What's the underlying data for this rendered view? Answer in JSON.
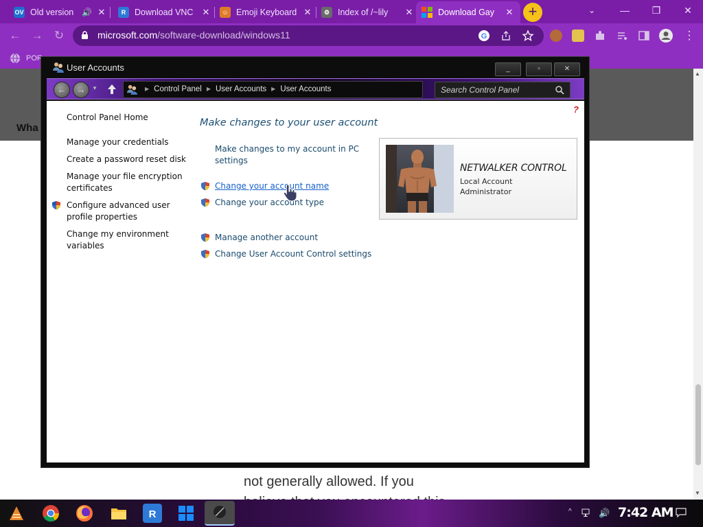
{
  "browser": {
    "tabs": [
      {
        "title": "Old version",
        "icon": "ov-icon",
        "icon_label": "OV",
        "icon_color": "#1f6fd1",
        "audio": true
      },
      {
        "title": "Download VNC",
        "icon": "realvnc-icon",
        "icon_label": "R",
        "icon_color": "#2d7ad6"
      },
      {
        "title": "Emoji Keyboard",
        "icon": "emoji-icon",
        "icon_label": "☺",
        "icon_color": "#e07b28"
      },
      {
        "title": "Index of /~lily",
        "icon": "folder-index-icon",
        "icon_label": "⚙",
        "icon_color": "#6a6a6a"
      },
      {
        "title": "Download Gay",
        "icon": "microsoft-icon",
        "icon_label": "",
        "icon_color": "#f25022",
        "active": true
      }
    ],
    "new_tab_label": "+",
    "window_controls": {
      "minimize": "—",
      "maximize": "❐",
      "close": "✕"
    },
    "url_host": "microsoft.com",
    "url_path": "/software-download/windows11",
    "bookmark_label": "POR"
  },
  "webpage": {
    "band_text": "Wha",
    "body_line1": "not generally allowed. If you",
    "body_line2": "believe that you encountered this"
  },
  "window": {
    "title": "User Accounts",
    "controls": {
      "minimize": "_",
      "maximize": "▫",
      "close": "✕"
    },
    "breadcrumb": [
      "Control Panel",
      "User Accounts",
      "User Accounts"
    ],
    "search_placeholder": "Search Control Panel",
    "help": "?"
  },
  "left_nav": {
    "home": "Control Panel Home",
    "credentials": "Manage your credentials",
    "reset_disk": "Create a password reset disk",
    "encryption": [
      "Manage your file encryption",
      "certificates"
    ],
    "advanced_profile": [
      "Configure advanced user",
      "profile properties"
    ],
    "env_vars": [
      "Change my environment",
      "variables"
    ]
  },
  "main": {
    "heading": "Make changes to your user account",
    "pc_settings": [
      "Make changes to my account in PC",
      "settings"
    ],
    "change_name": "Change your account name",
    "change_type": "Change your account type",
    "manage_another": "Manage another account",
    "uac_settings": "Change User Account Control settings"
  },
  "account": {
    "name": "NETWALKER CONTROL",
    "type": "Local Account",
    "role": "Administrator"
  },
  "taskbar": {
    "clock": "7:42 AM",
    "apps": [
      "chrome-icon",
      "firefox-icon",
      "file-explorer-icon",
      "realvnc-icon",
      "windows-start-icon",
      "media-app-icon"
    ]
  },
  "colors": {
    "browser_frame": "#7a1ea8",
    "browser_toolbar": "#8f2fc1",
    "window_frame": "#0d0d0d",
    "link_blue": "#1560c9",
    "heading_blue": "#1b4f72"
  }
}
